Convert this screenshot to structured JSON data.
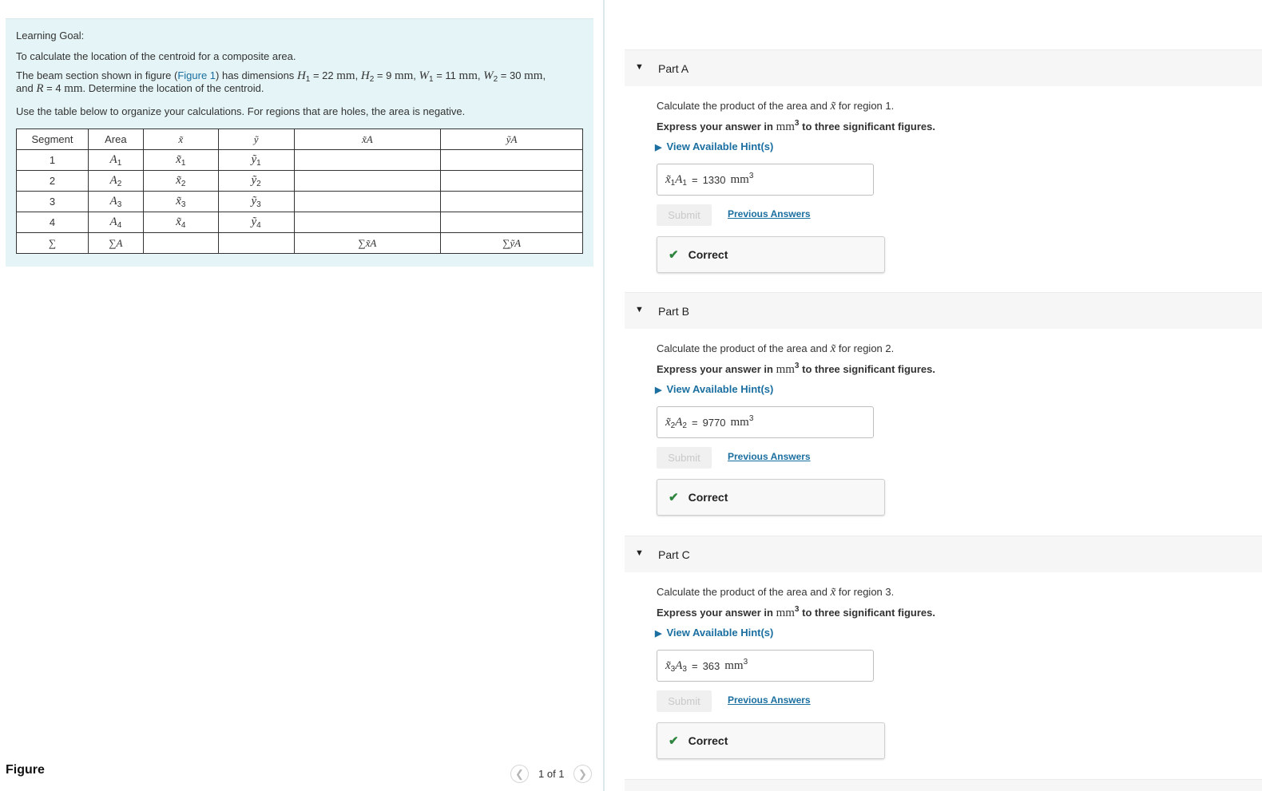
{
  "intro": {
    "learning_goal_label": "Learning Goal:",
    "goal_text": "To calculate the location of the centroid for a composite area.",
    "beam_prefix": "The beam section shown in figure (",
    "figure_link": "Figure 1",
    "beam_suffix": ") has dimensions",
    "dims": [
      {
        "sym": "H",
        "sub": "1",
        "val": "22",
        "unit": "mm"
      },
      {
        "sym": "H",
        "sub": "2",
        "val": "9",
        "unit": "mm"
      },
      {
        "sym": "W",
        "sub": "1",
        "val": "11",
        "unit": "mm"
      },
      {
        "sym": "W",
        "sub": "2",
        "val": "30",
        "unit": "mm"
      }
    ],
    "and_text": "and",
    "r_sym": "R",
    "r_val": "4",
    "r_unit": "mm",
    "determine_text": ". Determine the location of the centroid.",
    "table_instructions": "Use the table below to organize your calculations. For regions that are holes, the area is negative."
  },
  "table": {
    "headers": [
      "Segment",
      "Area",
      "x̃",
      "ỹ",
      "x̃A",
      "ỹA"
    ],
    "rows": [
      {
        "segment": "1",
        "area": "A",
        "area_sub": "1",
        "x": "x̃",
        "x_sub": "1",
        "y": "ỹ",
        "y_sub": "1"
      },
      {
        "segment": "2",
        "area": "A",
        "area_sub": "2",
        "x": "x̃",
        "x_sub": "2",
        "y": "ỹ",
        "y_sub": "2"
      },
      {
        "segment": "3",
        "area": "A",
        "area_sub": "3",
        "x": "x̃",
        "x_sub": "3",
        "y": "ỹ",
        "y_sub": "3"
      },
      {
        "segment": "4",
        "area": "A",
        "area_sub": "4",
        "x": "x̃",
        "x_sub": "4",
        "y": "ỹ",
        "y_sub": "4"
      }
    ],
    "sum_row": {
      "segment": "∑",
      "area": "∑A",
      "xa": "∑x̃A",
      "ya": "∑ỹA"
    }
  },
  "figure": {
    "label": "Figure",
    "pager": "1 of 1",
    "prev_icon": "chevron-left-icon",
    "next_icon": "chevron-right-icon"
  },
  "parts": [
    {
      "title": "Part A",
      "question_prefix": "Calculate the product of the area and",
      "question_sym": "x̃",
      "question_suffix": "for region 1.",
      "express_prefix": "Express your answer in",
      "express_unit": "mm",
      "express_unit_exp": "3",
      "express_suffix": "to three significant figures.",
      "hint_label": "View Available Hint(s)",
      "answer_label_x": "x̃",
      "answer_label_x_sub": "1",
      "answer_label_a": "A",
      "answer_label_a_sub": "1",
      "equals": "=",
      "answer_value": "1330",
      "answer_unit": "mm",
      "answer_unit_exp": "3",
      "submit_label": "Submit",
      "previous_answers_label": "Previous Answers",
      "status_label": "Correct"
    },
    {
      "title": "Part B",
      "question_prefix": "Calculate the product of the area and",
      "question_sym": "x̃",
      "question_suffix": "for region 2.",
      "express_prefix": "Express your answer in",
      "express_unit": "mm",
      "express_unit_exp": "3",
      "express_suffix": "to three significant figures.",
      "hint_label": "View Available Hint(s)",
      "answer_label_x": "x̃",
      "answer_label_x_sub": "2",
      "answer_label_a": "A",
      "answer_label_a_sub": "2",
      "equals": "=",
      "answer_value": "9770",
      "answer_unit": "mm",
      "answer_unit_exp": "3",
      "submit_label": "Submit",
      "previous_answers_label": "Previous Answers",
      "status_label": "Correct"
    },
    {
      "title": "Part C",
      "question_prefix": "Calculate the product of the area and",
      "question_sym": "x̃",
      "question_suffix": "for region 3.",
      "express_prefix": "Express your answer in",
      "express_unit": "mm",
      "express_unit_exp": "3",
      "express_suffix": "to three significant figures.",
      "hint_label": "View Available Hint(s)",
      "answer_label_x": "x̃",
      "answer_label_x_sub": "3",
      "answer_label_a": "A",
      "answer_label_a_sub": "3",
      "equals": "=",
      "answer_value": "363",
      "answer_unit": "mm",
      "answer_unit_exp": "3",
      "submit_label": "Submit",
      "previous_answers_label": "Previous Answers",
      "status_label": "Correct"
    }
  ],
  "colors": {
    "intro_background": "#e5f4f6",
    "link": "#1a6fa0",
    "correct_check": "#2e8540",
    "part_header_background": "#f6f6f6"
  }
}
